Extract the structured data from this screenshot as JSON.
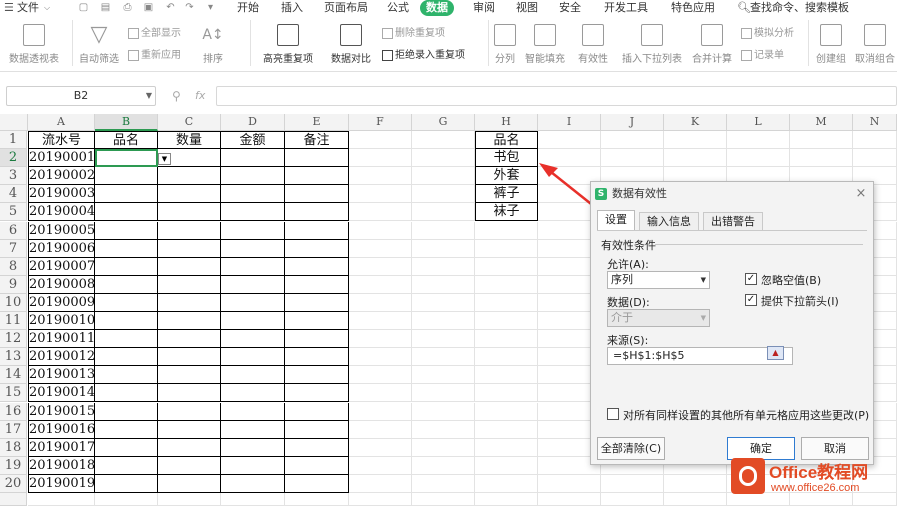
{
  "menu": {
    "file_label": "文件",
    "tabs": [
      "开始",
      "插入",
      "页面布局",
      "公式",
      "数据",
      "审阅",
      "视图",
      "安全",
      "开发工具",
      "特色应用"
    ],
    "active_tab": "数据",
    "search_label": "查找命令、搜索模板"
  },
  "ribbon": {
    "pivot_table": "数据透视表",
    "auto_filter": "自动筛选",
    "show_all": "全部显示",
    "reapply": "重新应用",
    "sort": "排序",
    "highlight_dup": "高亮重复项",
    "compare": "数据对比",
    "delete_dup": "删除重复项",
    "reject_dup": "拒绝录入重复项",
    "split": "分列",
    "smart_fill": "智能填充",
    "validity": "有效性",
    "insert_dropdown": "插入下拉列表",
    "consolidate": "合并计算",
    "what_if": "模拟分析",
    "record": "记录单",
    "group": "创建组",
    "ungroup": "取消组合"
  },
  "formula_bar": {
    "name_box": "B2",
    "fx": "fx",
    "formula": ""
  },
  "sheet": {
    "columns": [
      "A",
      "B",
      "C",
      "D",
      "E",
      "F",
      "G",
      "H",
      "I",
      "J",
      "K",
      "L",
      "M",
      "N"
    ],
    "rows": [
      "1",
      "2",
      "3",
      "4",
      "5",
      "6",
      "7",
      "8",
      "9",
      "10",
      "11",
      "12",
      "13",
      "14",
      "15",
      "16",
      "17",
      "18",
      "19",
      "20",
      ""
    ],
    "headers": [
      "流水号",
      "品名",
      "数量",
      "金额",
      "备注"
    ],
    "serials": [
      "20190001",
      "20190002",
      "20190003",
      "20190004",
      "20190005",
      "20190006",
      "20190007",
      "20190008",
      "20190009",
      "20190010",
      "20190011",
      "20190012",
      "20190013",
      "20190014",
      "20190015",
      "20190016",
      "20190017",
      "20190018",
      "20190019"
    ],
    "h_column": [
      "品名",
      "书包",
      "外套",
      "裤子",
      "袜子"
    ]
  },
  "dialog": {
    "title": "数据有效性",
    "close": "×",
    "tabs": [
      "设置",
      "输入信息",
      "出错警告"
    ],
    "section": "有效性条件",
    "allow_label": "允许(A):",
    "allow_value": "序列",
    "ignore_blank": "忽略空值(B)",
    "dropdown_arrow": "提供下拉箭头(I)",
    "data_label": "数据(D):",
    "data_value": "介于",
    "source_label": "来源(S):",
    "source_value": "=$H$1:$H$5",
    "apply_all": "对所有同样设置的其他所有单元格应用这些更改(P)",
    "clear_all": "全部清除(C)",
    "ok": "确定",
    "cancel": "取消"
  },
  "watermark": {
    "title": "Office教程网",
    "url": "www.office26.com"
  },
  "colors": {
    "accent": "#2fb36b",
    "selection": "#2d9a52",
    "arrow": "#e8302a",
    "watermark": "#e24b25"
  }
}
